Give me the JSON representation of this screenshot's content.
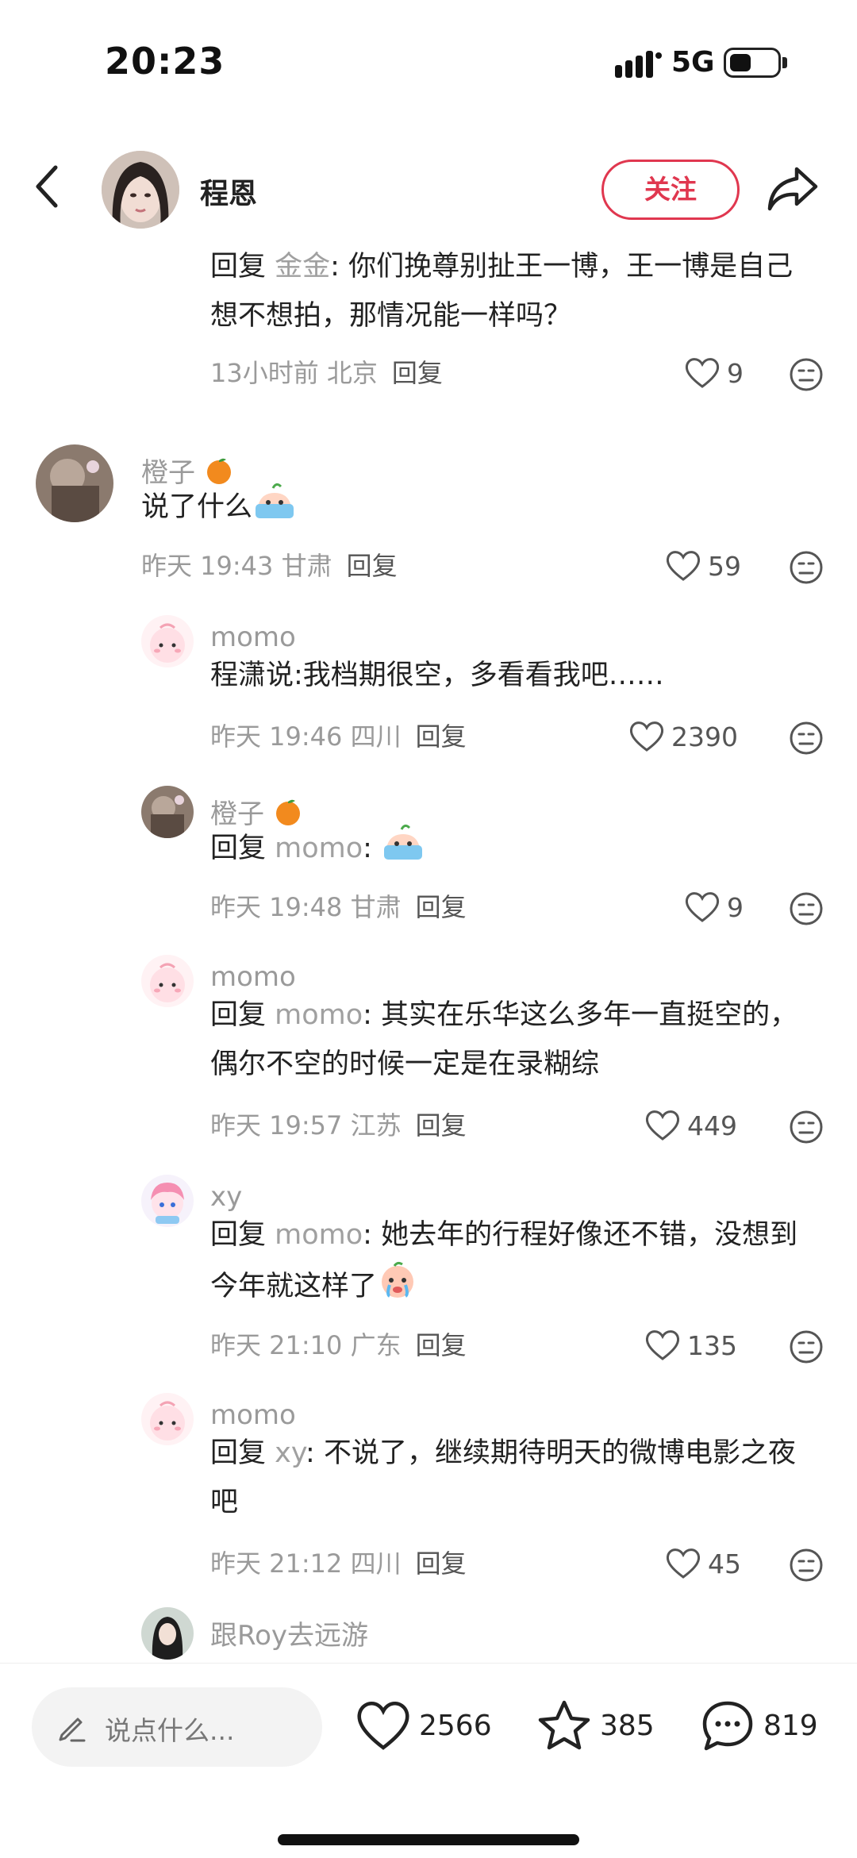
{
  "status_bar": {
    "time": "20:23",
    "network": "5G"
  },
  "header": {
    "name": "程恩",
    "follow_label": "关注"
  },
  "colors": {
    "accent": "#e0374f",
    "muted": "#9a9a9a"
  },
  "comments": [
    {
      "text_prefix": "回复 ",
      "ref": "金金",
      "text": ": 你们挽尊别扯王一博，王一博是自己想不想拍，那情况能一样吗？",
      "time": "13小时前",
      "location": "北京",
      "reply": "回复",
      "likes": "9"
    },
    {
      "name": "橙子",
      "name_emoji": "tangerine",
      "text": "说了什么",
      "text_emoji": "sweat-face",
      "time": "昨天 19:43",
      "location": "甘肃",
      "reply": "回复",
      "likes": "59"
    },
    {
      "name": "momo",
      "text": "程潇说:我档期很空，多看看我吧……",
      "time": "昨天 19:46",
      "location": "四川",
      "reply": "回复",
      "likes": "2390"
    },
    {
      "name": "橙子",
      "name_emoji": "tangerine",
      "text_prefix": "回复 ",
      "ref": "momo",
      "text": ": ",
      "text_emoji": "sweat-face",
      "time": "昨天 19:48",
      "location": "甘肃",
      "reply": "回复",
      "likes": "9"
    },
    {
      "name": "momo",
      "text_prefix": "回复 ",
      "ref": "momo",
      "text": ": 其实在乐华这么多年一直挺空的，偶尔不空的时候一定是在录糊综",
      "time": "昨天 19:57",
      "location": "江苏",
      "reply": "回复",
      "likes": "449"
    },
    {
      "name": "xy",
      "text_prefix": "回复 ",
      "ref": "momo",
      "text": ": 她去年的行程好像还不错，没想到今年就这样了",
      "text_emoji": "crying-face",
      "time": "昨天 21:10",
      "location": "广东",
      "reply": "回复",
      "likes": "135"
    },
    {
      "name": "momo",
      "text_prefix": "回复 ",
      "ref": "xy",
      "text": ": 不说了，继续期待明天的微博电影之夜吧",
      "time": "昨天 21:12",
      "location": "四川",
      "reply": "回复",
      "likes": "45"
    },
    {
      "name": "跟Roy去远游"
    }
  ],
  "bottom_bar": {
    "placeholder": "说点什么...",
    "likes": "2566",
    "favorites": "385",
    "comments": "819"
  },
  "icons": [
    "back-icon",
    "share-icon",
    "heart-icon",
    "dislike-icon",
    "pencil-icon",
    "star-icon",
    "chat-icon",
    "signal-icon",
    "battery-icon"
  ]
}
